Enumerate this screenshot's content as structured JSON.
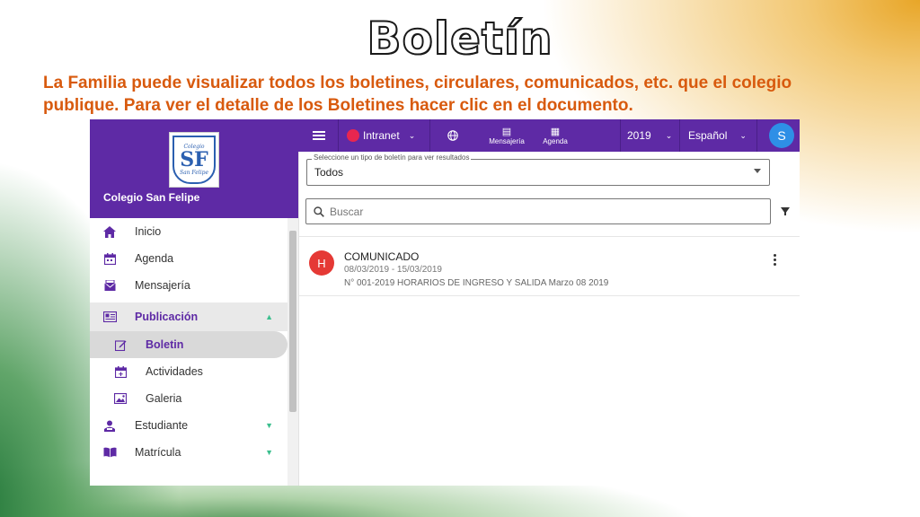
{
  "slide": {
    "title": "Boletín",
    "subtitle": "La Familia puede visualizar todos los boletines, circulares, comunicados, etc. que el colegio publique. Para ver el detalle de los Boletines hacer clic en el documento."
  },
  "colors": {
    "brand_purple": "#5e2aa5",
    "accent_green": "#3cbf8e",
    "intranet_dot": "#e8264f",
    "avatar_blue": "#2e8fe6",
    "item_avatar_red": "#e53935",
    "subtitle_orange": "#d85a0e"
  },
  "sidebar": {
    "logo": {
      "text_top": "Colegio",
      "text_big": "SF",
      "text_bottom": "San Felipe"
    },
    "school_name": "Colegio San Felipe",
    "items": [
      {
        "label": "Inicio",
        "icon": "home-icon"
      },
      {
        "label": "Agenda",
        "icon": "calendar-icon"
      },
      {
        "label": "Mensajería",
        "icon": "mail-icon"
      },
      {
        "label": "Publicación",
        "icon": "newspaper-icon",
        "expanded": true
      },
      {
        "label": "Boletin",
        "icon": "edit-icon",
        "active": true
      },
      {
        "label": "Actividades",
        "icon": "calendar-plus-icon"
      },
      {
        "label": "Galeria",
        "icon": "image-icon"
      },
      {
        "label": "Estudiante",
        "icon": "student-icon"
      },
      {
        "label": "Matrícula",
        "icon": "book-icon"
      }
    ]
  },
  "topbar": {
    "intranet_label": "Intranet",
    "mensajeria_label": "Mensajería",
    "agenda_label": "Agenda",
    "year": "2019",
    "language": "Español",
    "avatar_initial": "S"
  },
  "filter": {
    "legend": "Seleccione un tipo de boletín para ver resultados",
    "value": "Todos"
  },
  "search": {
    "placeholder": "Buscar"
  },
  "bulletins": [
    {
      "avatar": "H",
      "title": "COMUNICADO",
      "dates": "08/03/2019 - 15/03/2019",
      "description": "N° 001-2019 HORARIOS DE INGRESO Y SALIDA Marzo 08 2019"
    }
  ]
}
